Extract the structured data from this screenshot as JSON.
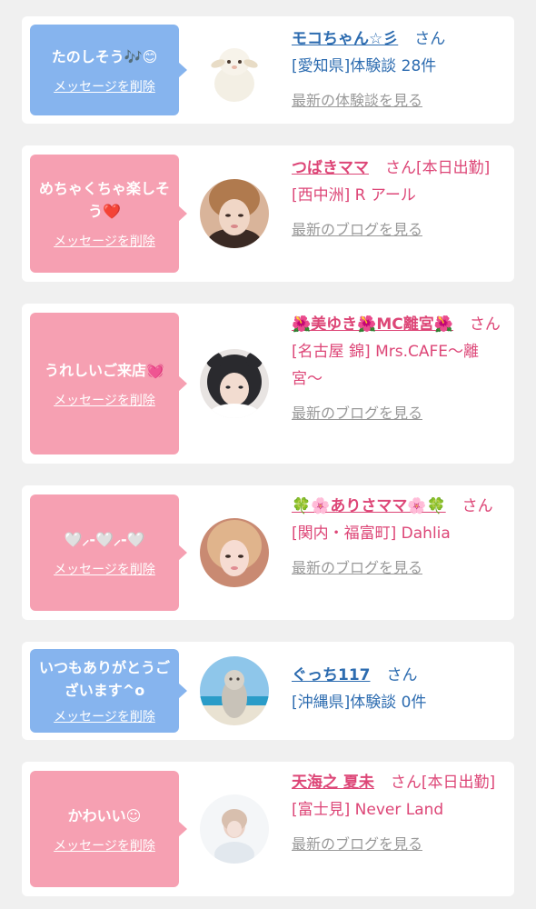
{
  "entries": [
    {
      "message": "たのしそう🎶😊",
      "delete_label": "メッセージを削除",
      "name": "モコちゃん☆彡",
      "suffix": "さん",
      "detail": "[愛知県]体験談 28件",
      "latest_label": "最新の体験談を見る",
      "avatar_icon": "sheep-plush-photo"
    },
    {
      "message": "めちゃくちゃ楽しそう❤️",
      "delete_label": "メッセージを削除",
      "name": "つばきママ",
      "suffix": "さん[本日出勤]",
      "detail": "[西中洲] R アール",
      "latest_label": "最新のブログを見る",
      "avatar_icon": "profile-photo"
    },
    {
      "message": "うれしいご来店💓",
      "delete_label": "メッセージを削除",
      "name": "🌺美ゆき🌺MC離宮🌺",
      "suffix": "さん",
      "detail": "[名古屋 錦] Mrs.CAFE〜離宮〜",
      "latest_label": "最新のブログを見る",
      "avatar_icon": "profile-photo"
    },
    {
      "message": "🤍⸝-🤍⸝-🤍",
      "delete_label": "メッセージを削除",
      "name": "🍀🌸ありさママ🌸🍀",
      "suffix": "さん",
      "detail": "[関内・福富町] Dahlia",
      "latest_label": "最新のブログを見る",
      "avatar_icon": "profile-photo"
    },
    {
      "message": "いつもありがとうございます^o",
      "delete_label": "メッセージを削除",
      "name": "ぐっち117",
      "suffix": "さん",
      "detail": "[沖縄県]体験談 0件",
      "latest_label": "",
      "avatar_icon": "shisa-statue-photo"
    },
    {
      "message": "かわいい☺︎",
      "delete_label": "メッセージを削除",
      "name": "天海之 夏未",
      "suffix": "さん[本日出勤]",
      "detail": "[富士見] Never Land",
      "latest_label": "最新のブログを見る",
      "avatar_icon": "profile-photo"
    }
  ],
  "colors": {
    "bubble_blue": "#86b4ee",
    "bubble_pink": "#f6a0b2",
    "text_blue": "#2d6cb0",
    "text_pink": "#dd4677",
    "link_gray": "#999999"
  }
}
